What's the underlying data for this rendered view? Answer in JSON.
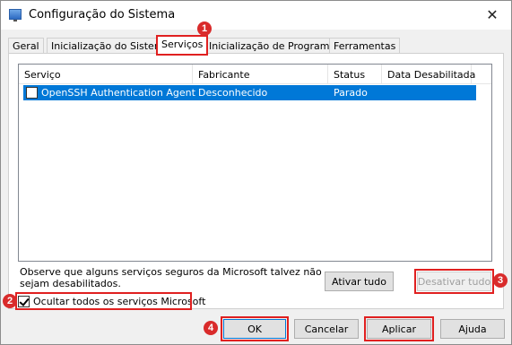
{
  "window": {
    "title": "Configuração do Sistema",
    "close_glyph": "✕"
  },
  "tabs": [
    {
      "label": "Geral"
    },
    {
      "label": "Inicialização do Sistema"
    },
    {
      "label": "Serviços"
    },
    {
      "label": "Inicialização de Programas"
    },
    {
      "label": "Ferramentas"
    }
  ],
  "table": {
    "columns": [
      "Serviço",
      "Fabricante",
      "Status",
      "Data Desabilitada"
    ],
    "rows": [
      {
        "checked": false,
        "service": "OpenSSH Authentication Agent",
        "manufacturer": "Desconhecido",
        "status": "Parado",
        "date_disabled": ""
      }
    ]
  },
  "note": "Observe que alguns serviços seguros da Microsoft talvez não sejam desabilitados.",
  "buttons": {
    "enable_all": "Ativar tudo",
    "disable_all": "Desativar tudo",
    "ok": "OK",
    "cancel": "Cancelar",
    "apply": "Aplicar",
    "help": "Ajuda"
  },
  "hide_microsoft": {
    "label": "Ocultar todos os serviços Microsoft",
    "checked": true
  },
  "annotations": [
    "1",
    "2",
    "3",
    "4"
  ],
  "colors": {
    "selection": "#0078d7",
    "highlight_red": "#e02020",
    "badge_red": "#d92b2b"
  }
}
